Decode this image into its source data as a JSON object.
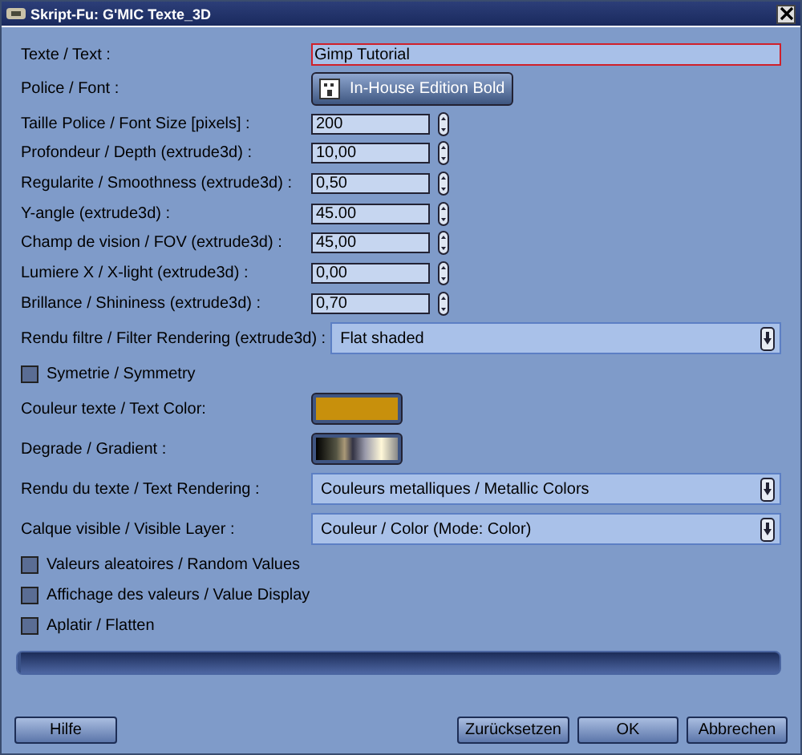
{
  "window": {
    "title": "Skript-Fu: G'MIC Texte_3D"
  },
  "rows": [
    {
      "kind": "text",
      "label": "Texte / Text :",
      "value": "Gimp Tutorial"
    },
    {
      "kind": "font",
      "label": "Police / Font :",
      "value": "In-House Edition Bold"
    },
    {
      "kind": "spin",
      "label": "Taille Police / Font Size [pixels] :",
      "value": "200"
    },
    {
      "kind": "spin",
      "label": "Profondeur / Depth (extrude3d) :",
      "value": "10,00"
    },
    {
      "kind": "spin",
      "label": "Regularite / Smoothness (extrude3d) :",
      "value": "0,50"
    },
    {
      "kind": "spin",
      "label": "Y-angle (extrude3d) :",
      "value": "45.00"
    },
    {
      "kind": "spin",
      "label": "Champ de vision / FOV (extrude3d) :",
      "value": "45,00"
    },
    {
      "kind": "spin",
      "label": "Lumiere X / X-light (extrude3d) :",
      "value": "0,00"
    },
    {
      "kind": "spin",
      "label": "Brillance / Shininess (extrude3d) :",
      "value": "0,70"
    },
    {
      "kind": "select",
      "label": "Rendu filtre / Filter Rendering (extrude3d) :",
      "value": "Flat shaded"
    },
    {
      "kind": "check",
      "label": "Symetrie / Symmetry",
      "checked": false
    },
    {
      "kind": "color",
      "label": "Couleur texte / Text Color:",
      "color": "#c8900c"
    },
    {
      "kind": "gradient",
      "label": "Degrade / Gradient :"
    },
    {
      "kind": "select",
      "label": "Rendu du texte / Text Rendering :",
      "value": "Couleurs metalliques / Metallic Colors"
    },
    {
      "kind": "select",
      "label": "Calque visible / Visible Layer :",
      "value": "Couleur / Color (Mode: Color)"
    },
    {
      "kind": "check",
      "label": "Valeurs aleatoires / Random Values",
      "checked": false
    },
    {
      "kind": "check",
      "label": "Affichage des valeurs / Value Display",
      "checked": false
    },
    {
      "kind": "check",
      "label": "Aplatir / Flatten",
      "checked": false
    }
  ],
  "progress": {
    "level": 0
  },
  "buttons_left": [
    "Hilfe"
  ],
  "buttons_right": [
    "Zurücksetzen",
    "OK",
    "Abbrechen"
  ]
}
